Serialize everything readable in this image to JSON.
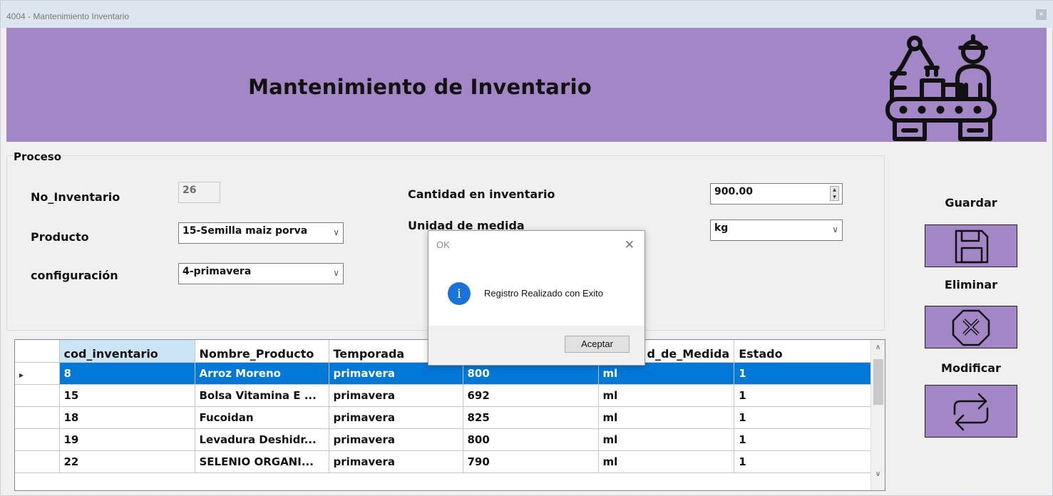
{
  "window": {
    "title": "4004 - Mantenimiento Inventario",
    "close_glyph": "×"
  },
  "header": {
    "title": "Mantenimiento de Inventario",
    "logo_icon": "factory-worker-icon",
    "background": "#a386c6"
  },
  "proceso": {
    "legend": "Proceso",
    "no_inventario": {
      "label": "No_Inventario",
      "value": "26"
    },
    "producto": {
      "label": "Producto",
      "value": "15-Semilla maiz porva"
    },
    "configuracion": {
      "label": "configuración",
      "value": "4-primavera"
    },
    "cantidad": {
      "label": "Cantidad en inventario",
      "value": "900.00"
    },
    "unidad": {
      "label": "Unidad de medida",
      "value": "kg"
    }
  },
  "actions": {
    "guardar": {
      "label": "Guardar",
      "icon": "save-icon"
    },
    "eliminar": {
      "label": "Eliminar",
      "icon": "delete-icon"
    },
    "modificar": {
      "label": "Modificar",
      "icon": "refresh-icon"
    }
  },
  "grid": {
    "columns": [
      "cod_inventario",
      "Nombre_Producto",
      "Temporada",
      "",
      "d_de_Medida",
      "Estado"
    ],
    "rows": [
      [
        "8",
        "Arroz Moreno",
        "primavera",
        "800",
        "ml",
        "1"
      ],
      [
        "15",
        "Bolsa Vitamina E ...",
        "primavera",
        "692",
        "ml",
        "1"
      ],
      [
        "18",
        "Fucoidan",
        "primavera",
        "825",
        "ml",
        "1"
      ],
      [
        "19",
        "Levadura Deshidr...",
        "primavera",
        "800",
        "ml",
        "1"
      ],
      [
        "22",
        "SELENIO ORGANI...",
        "primavera",
        "790",
        "ml",
        "1"
      ]
    ],
    "selected_row": 0
  },
  "dialog": {
    "title": "OK",
    "message": "Registro Realizado con Exito",
    "button": "Aceptar",
    "icon": "info-icon"
  }
}
